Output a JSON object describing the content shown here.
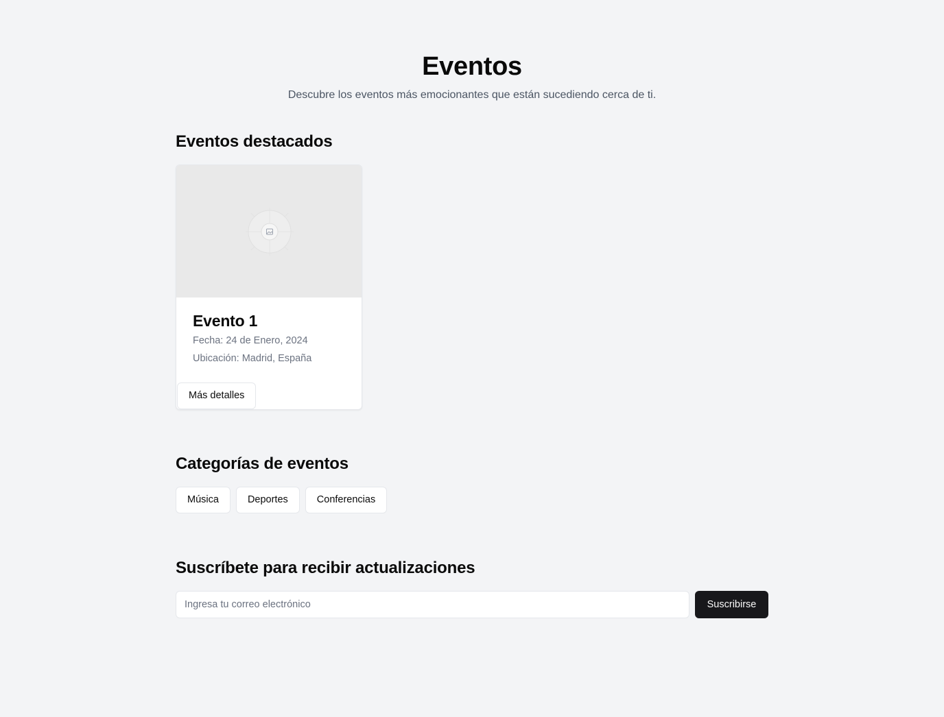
{
  "hero": {
    "title": "Eventos",
    "subtitle": "Descubre los eventos más emocionantes que están sucediendo cerca de ti."
  },
  "featured": {
    "heading": "Eventos destacados",
    "events": [
      {
        "title": "Evento 1",
        "date": "Fecha: 24 de Enero, 2024",
        "location": "Ubicación: Madrid, España",
        "button_label": "Más detalles",
        "image_icon": "image-placeholder-icon"
      }
    ]
  },
  "categories": {
    "heading": "Categorías de eventos",
    "items": [
      {
        "label": "Música"
      },
      {
        "label": "Deportes"
      },
      {
        "label": "Conferencias"
      }
    ]
  },
  "subscribe": {
    "heading": "Suscríbete para recibir actualizaciones",
    "email_placeholder": "Ingresa tu correo electrónico",
    "email_value": "",
    "button_label": "Suscribirse"
  },
  "colors": {
    "background": "#f3f4f6",
    "primary_button": "#18181b",
    "muted_text": "#6b7280",
    "border": "#e5e7eb"
  }
}
